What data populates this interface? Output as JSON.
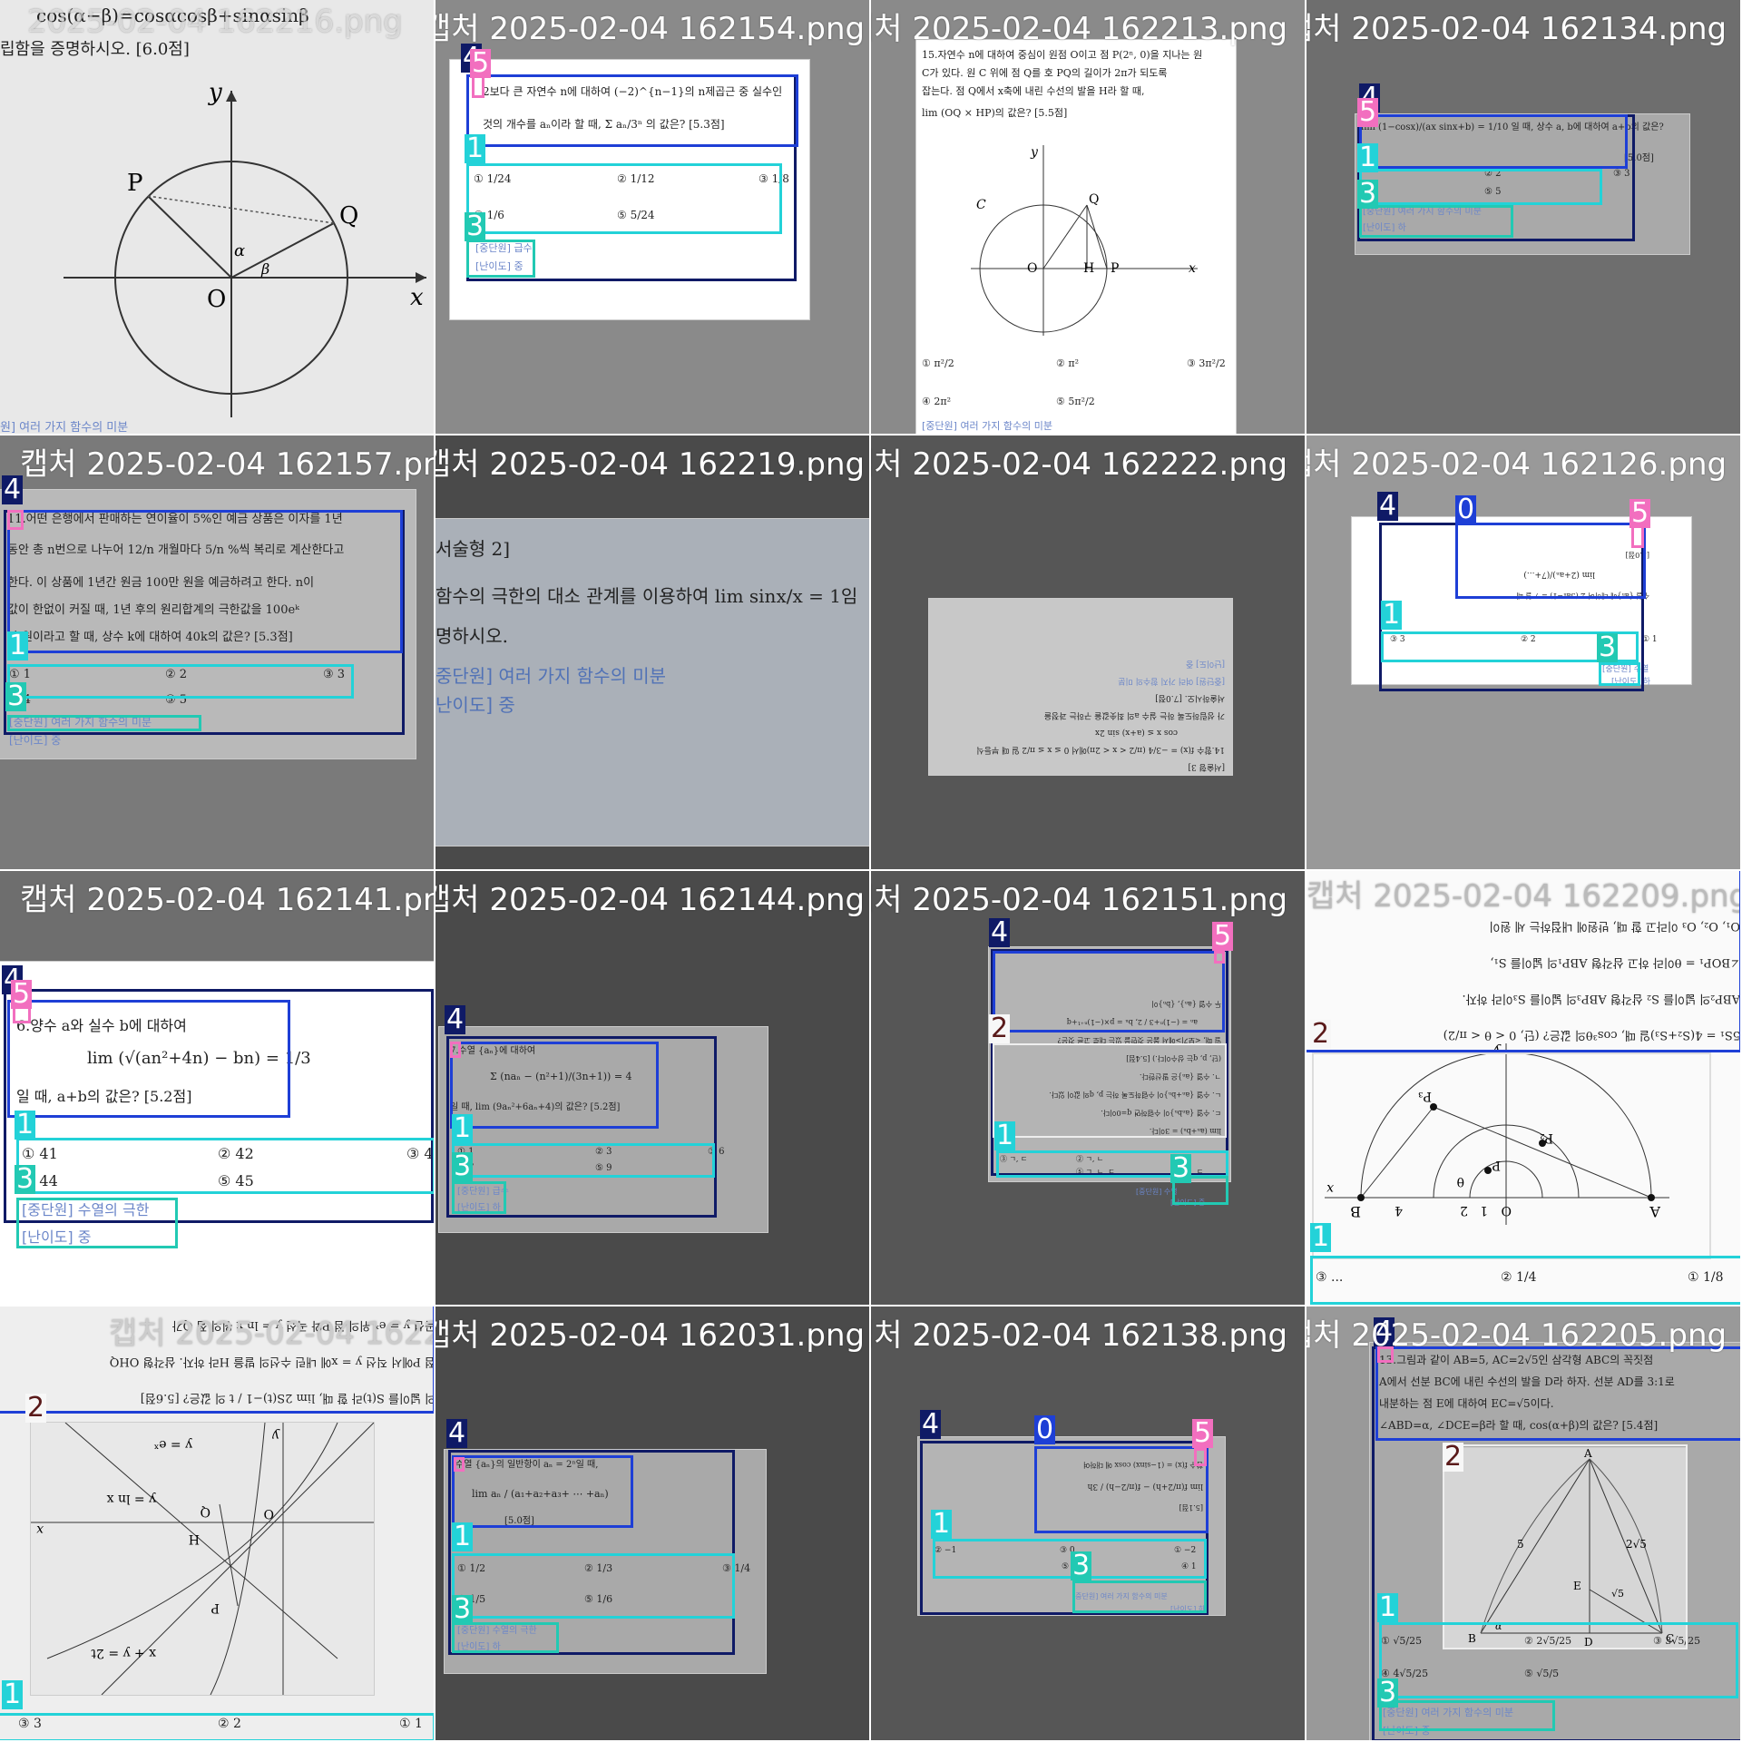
{
  "tiles": [
    {
      "filename": "2025-02-04 162216.png",
      "formula": "cos(α−β)=cosαcosβ+sinαsinβ",
      "instruction": "립함을 증명하시오. [6.0점]",
      "axis_y": "y",
      "axis_x": "x",
      "origin": "O",
      "pt_p": "P",
      "pt_q": "Q",
      "alpha": "α",
      "beta": "β",
      "footer": "원] 여러 가지 함수의 미분"
    },
    {
      "filename": "캡처 2025-02-04 162154.png",
      "question": "2보다 큰 자연수 n에 대하여 (−2)^{n−1}의 n제곱근 중 실수인",
      "question2": "것의 개수를 aₙ이라 할 때, Σ aₙ/3ⁿ 의 값은? [5.3점]",
      "options": [
        "① 1/24",
        "② 1/12",
        "③ 1/8",
        "④ 1/6",
        "⑤ 5/24"
      ],
      "unit": "[중단원] 급수",
      "level": "[난이도] 중",
      "labels": [
        "4",
        "5",
        "1",
        "3"
      ]
    },
    {
      "filename": "캡처 2025-02-04 162213.png",
      "question": "15.자연수 n에 대하여 중심이 원점 O이고 점 P(2ⁿ, 0)을 지나는 원",
      "question2": "C가 있다. 원 C 위에 점 Q를 호 PQ의 길이가 2π가 되도록",
      "question3": "잡는다. 점 Q에서 x축에 내린 수선의 발을 H라 할 때,",
      "question4": "lim (OQ × HP)의 값은? [5.5점]",
      "options": [
        "① π²/2",
        "② π²",
        "③ 3π²/2",
        "④ 2π²",
        "⑤ 5π²/2"
      ],
      "unit": "[중단원] 여러 가지 함수의 미분",
      "pt_c": "C",
      "pt_q": "Q",
      "pt_o": "O",
      "pt_h": "H",
      "pt_p": "P",
      "axis_x": "x",
      "axis_y": "y"
    },
    {
      "filename": "캡처 2025-02-04 162134.png",
      "question": "lim (1−cosx)/(ax sinx+b) = 1/10 일 때, 상수 a, b에 대하여 a+b의 값은?",
      "score": "[5.0점]",
      "options": [
        "② 2",
        "③ 3",
        "⑤ 5"
      ],
      "unit": "[중단원] 여러 가지 함수의 미분",
      "level": "[난이도] 하"
    },
    {
      "filename": "캡처 2025-02-04 162157.png",
      "lines": [
        "11.어떤 은행에서 판매하는 연이율이 5%인 예금 상품은 이자를 1년",
        "동안 총 n번으로 나누어 12/n 개월마다 5/n %씩 복리로 계산한다고",
        "한다. 이 상품에 1년간 원금 100만 원을 예금하려고 한다. n이",
        "값이 한없이 커질 때, 1년 후의 원리합계의 극한값을 100eᵏ",
        "만 원이라고 할 때, 상수 k에 대하여 40k의 값은? [5.3점]"
      ],
      "options": [
        "① 1",
        "② 2",
        "③ 3",
        "④ 4",
        "⑤ 5"
      ],
      "unit": "[중단원] 여러 가지 함수의 미분",
      "level": "[난이도] 중"
    },
    {
      "filename": "캡처 2025-02-04 162219.png",
      "head": "서술형 2]",
      "line1": "함수의 극한의 대소 관계를 이용하여 lim sinx/x = 1임",
      "line2": "명하시오.",
      "unit": "중단원] 여러 가지 함수의 미분",
      "level": "난이도] 중"
    },
    {
      "filename": "캡처 2025-02-04 162222.png",
      "lines": [
        "[서술형 3]",
        "14.함수 f(x) = −3/4 (π/2 < x < 2π)에서 0 ≤ x ≤ π/2 일 때 부등식",
        "cos x ≤ (a+x) sin 2x",
        "가 성립하도록 하는 실수 a의 최솟값을 구하는 과정을",
        "서술하시오. [7.0점]",
        "[중단원] 여러 가지 함수의 미분",
        "[난이도] 중"
      ]
    },
    {
      "filename": "캡처 2025-02-04 162126.png",
      "question": "수열 {aₙ}에 대하여 Σ (3aₙ−1) = 7 일 때",
      "formula": "lim (2+aₙ)/(7+...)",
      "score": "[5.0점]",
      "options": [
        "① 1",
        "② 2",
        "③ 3"
      ],
      "unit": "[중단원] 수열",
      "level": "[난이도] 하"
    },
    {
      "filename": "캡처 2025-02-04 162141.png",
      "question": "6.양수 a와 실수 b에 대하여",
      "formula": "lim (√(an²+4n) − bn) = 1/3",
      "question2": "일 때, a+b의 값은? [5.2점]",
      "options": [
        "① 41",
        "② 42",
        "③ 43",
        "④ 44",
        "⑤ 45"
      ],
      "unit": "[중단원] 수열의 극한",
      "level": "[난이도] 중"
    },
    {
      "filename": "캡처 2025-02-04 162144.png",
      "question": "7.수열 {aₙ}에 대하여",
      "formula": "Σ (naₙ − (n²+1)/(3n+1)) = 4",
      "question2": "일 때, lim (9aₙ²+6aₙ+4)의 값은? [5.2점]",
      "options": [
        "① 1",
        "② 3",
        "③ 6",
        "④ 7",
        "⑤ 9"
      ],
      "unit": "[중단원] 급수",
      "level": "[난이도] 하"
    },
    {
      "filename": "캡처 2025-02-04 162151.png",
      "lines": [
        "두 수열 {aₙ}, {bₙ}이",
        "aₙ = (−1)ⁿ+3 / 2, bₙ = p×(−1)ⁿ⁺¹+q",
        "일 때, <보기>에서 옳은 것만을 있는 대로 고른 것은?",
        "(단, p, q는 상수이다.) [5.4점]",
        "ㄱ. 수열 {aₙ}은 발산한다.",
        "ㄴ. 수열 {aₙ+bₙ}이 수렴하도록 하는 p, q의 값이 있다.",
        "ㄷ. 수열 {aₙbₙ}이 수렴하면 q=0이다.",
        "lim (aₙ+bₙ) = 3이다."
      ],
      "options": [
        "① ㄱ",
        "② ㄱ, ㄴ",
        "③ ㄱ, ㄷ",
        "④ ㄴ, ㄷ",
        "⑤ ㄱ, ㄴ, ㄷ"
      ],
      "unit": "[중단원] 수열",
      "level": "[난이도] 중"
    },
    {
      "filename": "캡처 2025-02-04 162209.png",
      "lines": [
        "O₁, O₂, O₃ 이라고 할 때, 반원에 내접하는 세 원이",
        "∠BOP₁ = θ이라 하고 삼각형 ABP₁의 넓이를 S₁,",
        "ABP₂의 넓이를 S₂ 삼각형 ABP₃의 넓이를 S₃이라 하자.",
        "5S₁ = 4(S₂+S₃)일 때, cos³θ의 값은? (단, 0 < θ < π/2)"
      ],
      "axis_y": "y",
      "axis_x": "x",
      "pts": [
        "A",
        "B",
        "P",
        "P₂",
        "P₃",
        "O",
        "θ",
        "1",
        "2",
        "4"
      ],
      "options": [
        "① 1/8",
        "② 1/4",
        "③ ..."
      ]
    },
    {
      "filename": "캡처 2025-02-04 162200.png",
      "lines": [
        "곡선 y = eˣ 위의 점 P와 곡선 y = ln x 위의 점 Q가",
        "점 P에서 직선 y = x에 내린 수선의 발을 H라 하자. 삼각형 OHQ",
        "의 넓이를 S(t)라 할 때, lim 2S(t)−1 / t 의 값은? [5.6점]"
      ],
      "curve1": "y = eˣ",
      "curve2": "y = ln x",
      "curve3": "x + y = 2t",
      "pts": [
        "Q",
        "H",
        "O",
        "P",
        "x",
        "y"
      ],
      "options": [
        "① 1",
        "② 2",
        "③ 3"
      ]
    },
    {
      "filename": "캡처 2025-02-04 162031.png",
      "question": "수열 {aₙ}의 일반항이 aₙ = 2ⁿ일 때,",
      "formula": "lim aₙ / (a₁+a₂+a₃+ ⋯ +aₙ)",
      "score": "[5.0점]",
      "options": [
        "① 1/2",
        "② 1/3",
        "③ 1/4",
        "④ 1/5",
        "⑤ 1/6"
      ],
      "unit": "[중단원] 수열의 극한",
      "level": "[난이도] 하"
    },
    {
      "filename": "캡처 2025-02-04 162138.png",
      "question": "함수 f(x) = (1−sinx) cosx 에 대하여",
      "formula": "lim f(π/2+h) − f(π/2−h) / 3h",
      "score": "[5.1점]",
      "options": [
        "① −2",
        "② −1",
        "③ 0",
        "④ 1",
        "⑤ 2"
      ],
      "unit": "[중단원] 여러 가지 함수의 미분",
      "level": "[난이도] 하"
    },
    {
      "filename": "캡처 2025-02-04 162205.png",
      "lines": [
        "13.그림과 같이 AB=5, AC=2√5인 삼각형 ABC의 꼭짓점",
        "A에서 선분 BC에 내린 수선의 발을 D라 하자. 선분 AD를 3:1로",
        "내분하는 점 E에 대하여 EC=√5이다.",
        "∠ABD=α, ∠DCE=β라 할 때, cos(α+β)의 값은? [5.4점]"
      ],
      "pts": [
        "A",
        "B",
        "C",
        "D",
        "E",
        "5",
        "2√5",
        "√5",
        "α"
      ],
      "options": [
        "① √5/25",
        "② 2√5/25",
        "③ 3√5/25",
        "④ 4√5/25",
        "⑤ √5/5"
      ],
      "unit": "[중단원] 여러 가지 함수의 미분",
      "level": "[난이도] 중"
    }
  ],
  "colors": {
    "navy": "#0f1a66",
    "blue": "#1e3fd6",
    "cyan": "#23d2d8",
    "teal": "#22c9b3",
    "pink": "#f26fbf"
  },
  "tag_labels": {
    "four": "4",
    "five": "5",
    "one": "1",
    "three": "3",
    "two": "2",
    "zero": "0"
  }
}
